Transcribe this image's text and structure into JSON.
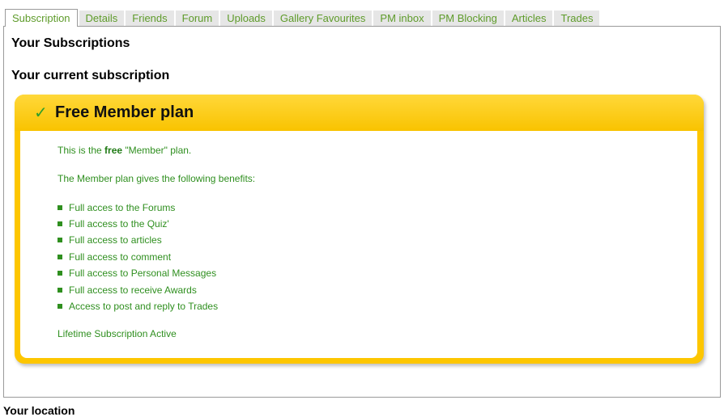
{
  "tabs": [
    {
      "label": "Subscription",
      "active": true
    },
    {
      "label": "Details"
    },
    {
      "label": "Friends"
    },
    {
      "label": "Forum"
    },
    {
      "label": "Uploads"
    },
    {
      "label": "Gallery Favourites"
    },
    {
      "label": "PM inbox"
    },
    {
      "label": "PM Blocking"
    },
    {
      "label": "Articles"
    },
    {
      "label": "Trades"
    }
  ],
  "headings": {
    "subscriptions": "Your Subscriptions",
    "current": "Your current subscription",
    "location": "Your location"
  },
  "plan": {
    "check_glyph": "✓",
    "title": "Free Member plan",
    "intro_prefix": "This is the ",
    "intro_bold": "free",
    "intro_suffix": " \"Member\" plan.",
    "benefits_intro": "The Member plan gives the following benefits:",
    "benefits": [
      "Full acces to the Forums",
      "Full access to the Quiz'",
      "Full access to articles",
      "Full access to comment",
      "Full access to Personal Messages",
      "Full access to receive Awards",
      "Access to post and reply to Trades"
    ],
    "status": "Lifetime Subscription Active"
  },
  "colors": {
    "plan_gold": "#fdc600",
    "text_green": "#2f8f1f",
    "tab_text": "#5e9b2a"
  }
}
